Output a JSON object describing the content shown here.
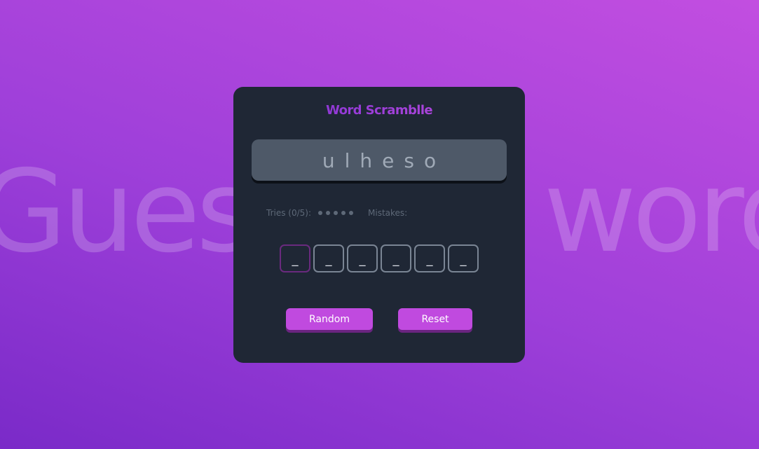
{
  "background_text": "Guess the word",
  "app": {
    "title": "Word Scramblle"
  },
  "scrambled_word": "ulheso",
  "stats": {
    "tries_label": "Tries (0/5):",
    "tries_used": 0,
    "tries_total": 5,
    "mistakes_label": "Mistakes:",
    "mistakes_value": ""
  },
  "letter_slots": [
    "_",
    "_",
    "_",
    "_",
    "_",
    "_"
  ],
  "buttons": {
    "random_label": "Random",
    "reset_label": "Reset"
  },
  "colors": {
    "accent": "#c04adf",
    "card_bg": "#1f2735",
    "scramble_bg": "#4e5968"
  }
}
